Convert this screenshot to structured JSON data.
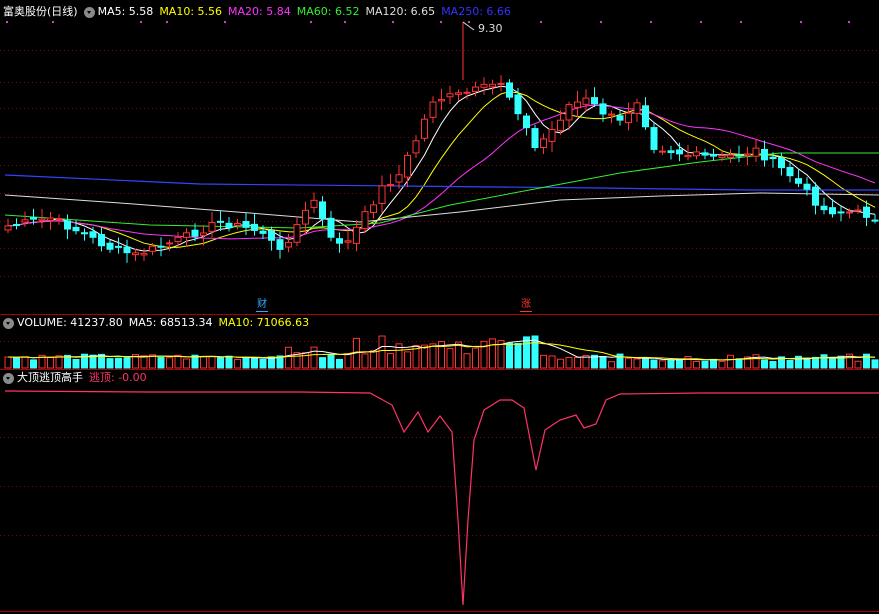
{
  "main_panel": {
    "title": "富奥股份(日线)",
    "ma_labels": [
      {
        "text": "MA5: 5.58",
        "color": "#ffffff"
      },
      {
        "text": "MA10: 5.56",
        "color": "#ffff00"
      },
      {
        "text": "MA20: 5.84",
        "color": "#ff33ff"
      },
      {
        "text": "MA60: 6.52",
        "color": "#33ee33"
      },
      {
        "text": "MA120: 6.65",
        "color": "#dddddd"
      },
      {
        "text": "MA250: 6.66",
        "color": "#3333ff"
      }
    ],
    "peak_label": "9.30",
    "events": [
      {
        "text": "财",
        "color": "#33aaff"
      },
      {
        "text": "涨",
        "color": "#ff3333"
      }
    ]
  },
  "volume_panel": {
    "labels": [
      {
        "text": "VOLUME: 41237.80",
        "color": "#ffffff"
      },
      {
        "text": "MA5: 68513.34",
        "color": "#ffffff"
      },
      {
        "text": "MA10: 71066.63",
        "color": "#ffff00"
      }
    ]
  },
  "indicator_panel": {
    "name": "大顶逃顶高手",
    "value_label": "逃顶: -0.00",
    "value_color": "#ff3366"
  },
  "colors": {
    "up": "#ff3333",
    "down": "#33ffff",
    "grid": "#880000",
    "separator": "#aa0000"
  }
}
